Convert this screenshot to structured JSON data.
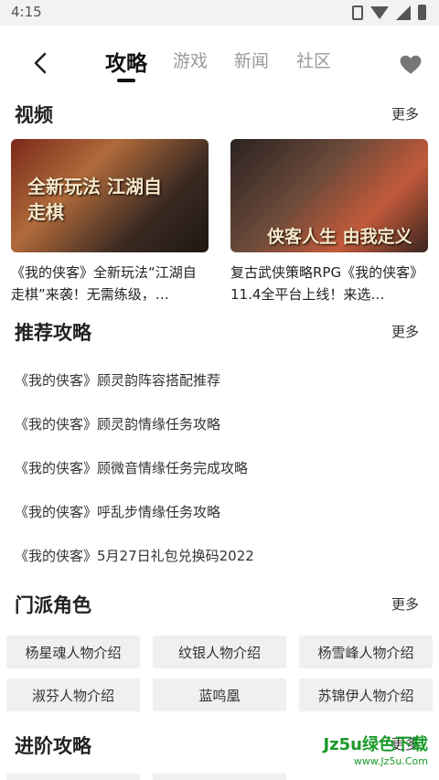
{
  "status_bar": {
    "time": "4:15"
  },
  "header": {
    "tabs": [
      {
        "label": "攻略",
        "active": true
      },
      {
        "label": "游戏",
        "active": false
      },
      {
        "label": "新闻",
        "active": false
      },
      {
        "label": "社区",
        "active": false
      }
    ]
  },
  "videos": {
    "title": "视频",
    "more": "更多",
    "items": [
      {
        "caption": "《我的侠客》全新玩法“江湖自走棋”来袭！无需练级，…",
        "thumb_text": "全新玩法 江湖自走棋"
      },
      {
        "caption": "复古武侠策略RPG《我的侠客》11.4全平台上线！来选…",
        "thumb_text": "侠客人生 由我定义"
      }
    ]
  },
  "recommended": {
    "title": "推荐攻略",
    "more": "更多",
    "items": [
      "《我的侠客》顾灵韵阵容搭配推荐",
      "《我的侠客》顾灵韵情缘任务攻略",
      "《我的侠客》顾微音情缘任务完成攻略",
      "《我的侠客》呼乱步情缘任务攻略",
      "《我的侠客》5月27日礼包兑换码2022"
    ]
  },
  "factions": {
    "title": "门派角色",
    "more": "更多",
    "items": [
      "杨星魂人物介绍",
      "纹银人物介绍",
      "杨雪峰人物介绍",
      "淑芬人物介绍",
      "蓝鸣凰",
      "苏锦伊人物介绍"
    ]
  },
  "advanced": {
    "title": "进阶攻略",
    "more": "更多"
  },
  "watermark": {
    "main": "Jz5u绿色下载",
    "sub": "www.Jz5u.Com"
  }
}
